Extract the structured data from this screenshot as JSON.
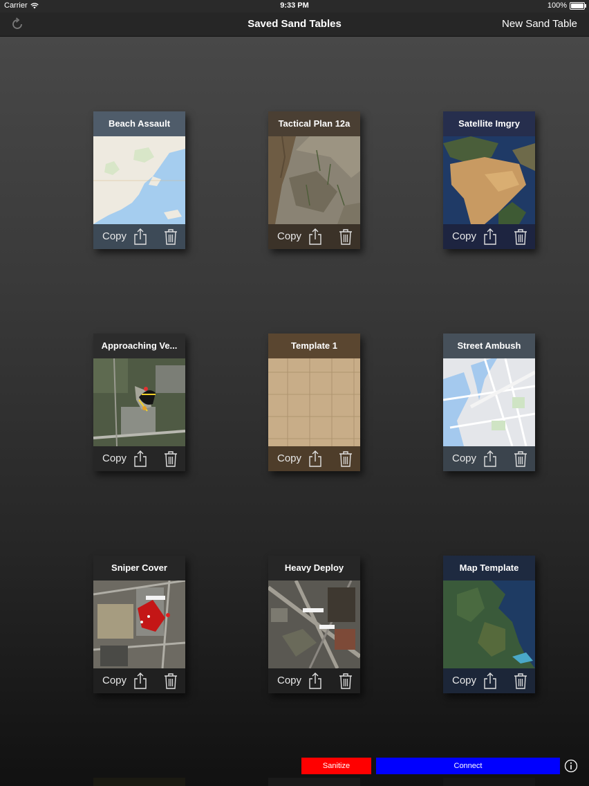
{
  "status": {
    "carrier": "Carrier",
    "time": "9:33 PM",
    "battery": "100%"
  },
  "nav": {
    "title": "Saved Sand Tables",
    "action": "New Sand Table"
  },
  "cards": [
    {
      "title": "Beach Assault",
      "copy": "Copy"
    },
    {
      "title": "Tactical Plan 12a",
      "copy": "Copy"
    },
    {
      "title": "Satellite Imgry",
      "copy": "Copy"
    },
    {
      "title": "Approaching Ve...",
      "copy": "Copy"
    },
    {
      "title": "Template 1",
      "copy": "Copy"
    },
    {
      "title": "Street Ambush",
      "copy": "Copy"
    },
    {
      "title": "Sniper Cover",
      "copy": "Copy"
    },
    {
      "title": "Heavy Deploy",
      "copy": "Copy"
    },
    {
      "title": "Map Template",
      "copy": "Copy"
    }
  ],
  "actions": {
    "sanitize": "Sanitize",
    "connect": "Connect"
  },
  "colors": {
    "sanitize": "#ff0000",
    "connect": "#0000ff"
  },
  "icons": {
    "refresh": "refresh-icon",
    "share": "share-icon",
    "trash": "trash-icon",
    "info": "info-icon",
    "wifi": "wifi-icon",
    "battery": "battery-icon"
  }
}
